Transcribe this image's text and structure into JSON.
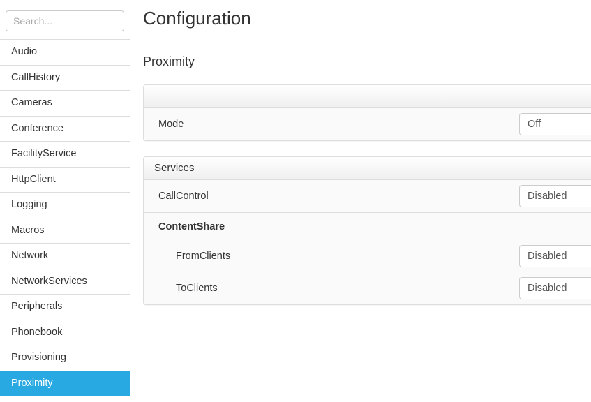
{
  "sidebar": {
    "search": {
      "placeholder": "Search...",
      "value": ""
    },
    "items": [
      {
        "label": "Audio",
        "active": false
      },
      {
        "label": "CallHistory",
        "active": false
      },
      {
        "label": "Cameras",
        "active": false
      },
      {
        "label": "Conference",
        "active": false
      },
      {
        "label": "FacilityService",
        "active": false
      },
      {
        "label": "HttpClient",
        "active": false
      },
      {
        "label": "Logging",
        "active": false
      },
      {
        "label": "Macros",
        "active": false
      },
      {
        "label": "Network",
        "active": false
      },
      {
        "label": "NetworkServices",
        "active": false
      },
      {
        "label": "Peripherals",
        "active": false
      },
      {
        "label": "Phonebook",
        "active": false
      },
      {
        "label": "Provisioning",
        "active": false
      },
      {
        "label": "Proximity",
        "active": true
      }
    ]
  },
  "main": {
    "page_title": "Configuration",
    "section_title": "Proximity",
    "panels": [
      {
        "heading": "",
        "rows": [
          {
            "label": "Mode",
            "type": "select",
            "value": "Off",
            "indent": false,
            "bold": false,
            "bordered": false
          }
        ]
      },
      {
        "heading": "Services",
        "rows": [
          {
            "label": "CallControl",
            "type": "select",
            "value": "Disabled",
            "indent": false,
            "bold": false,
            "bordered": false
          },
          {
            "label": "ContentShare",
            "type": "group",
            "value": "",
            "indent": false,
            "bold": true,
            "bordered": true
          },
          {
            "label": "FromClients",
            "type": "select",
            "value": "Disabled",
            "indent": true,
            "bold": false,
            "bordered": false
          },
          {
            "label": "ToClients",
            "type": "select",
            "value": "Disabled",
            "indent": true,
            "bold": false,
            "bordered": false
          }
        ]
      }
    ]
  },
  "colors": {
    "accent": "#29a9e1",
    "border": "#dddddd",
    "panel_bg": "#fafafa",
    "text": "#333333"
  },
  "icons": {
    "caret": "chevron-down-icon"
  }
}
